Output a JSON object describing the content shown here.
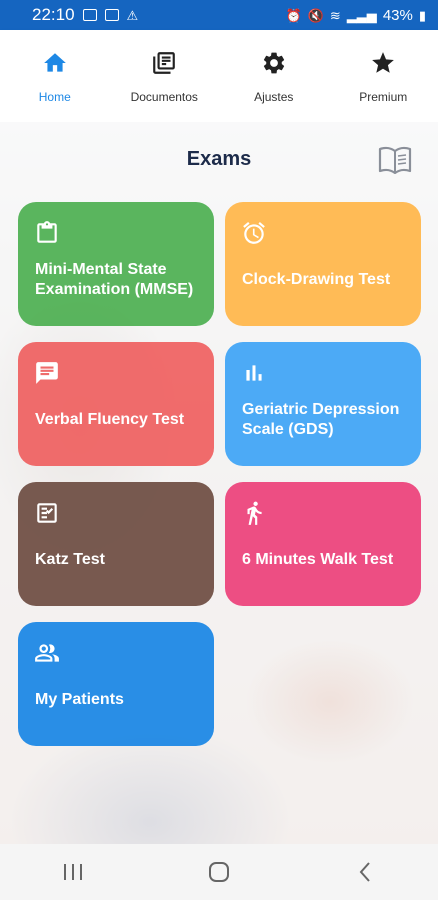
{
  "status_bar": {
    "time": "22:10",
    "battery": "43%"
  },
  "tabs": [
    {
      "label": "Home",
      "icon": "home-icon",
      "active": true
    },
    {
      "label": "Documentos",
      "icon": "documents-icon",
      "active": false
    },
    {
      "label": "Ajustes",
      "icon": "gear-icon",
      "active": false
    },
    {
      "label": "Premium",
      "icon": "star-icon",
      "active": false
    }
  ],
  "main": {
    "title": "Exams",
    "cards": [
      {
        "label": "Mini-Mental State Examination (MMSE)",
        "icon": "clipboard-icon",
        "color": "#4caf50"
      },
      {
        "label": "Clock-Drawing Test",
        "icon": "alarm-clock-icon",
        "color": "#ffb74d"
      },
      {
        "label": "Verbal Fluency Test",
        "icon": "chat-icon",
        "color": "#ef5f5f"
      },
      {
        "label": "Geriatric Depression Scale (GDS)",
        "icon": "bar-chart-icon",
        "color": "#42a5f5"
      },
      {
        "label": "Katz Test",
        "icon": "checklist-icon",
        "color": "#6d4c41"
      },
      {
        "label": "6 Minutes Walk Test",
        "icon": "walking-icon",
        "color": "#ec407a"
      },
      {
        "label": "My Patients",
        "icon": "people-icon",
        "color": "#1e88e5"
      }
    ]
  },
  "colors": {
    "status_bar": "#1565c0",
    "accent": "#1e88e5"
  }
}
